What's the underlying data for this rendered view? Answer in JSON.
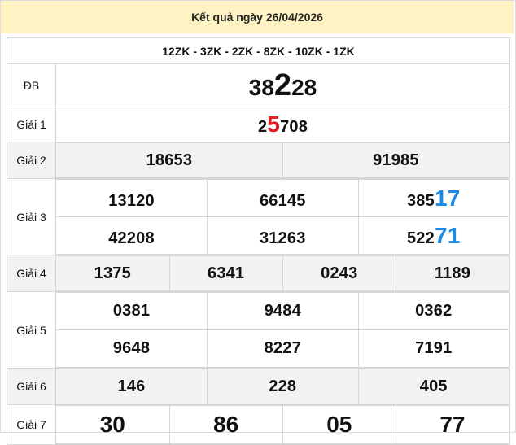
{
  "title": "Kết quả ngày 26/04/2026",
  "codes": "12ZK - 3ZK - 2ZK - 8ZK - 10ZK - 1ZK",
  "prizes": {
    "db": {
      "label": "ĐB",
      "a": "38",
      "b": "2",
      "c": "28"
    },
    "g1": {
      "label": "Giải 1",
      "a": "2",
      "b": "5",
      "c": "708"
    },
    "g2": {
      "label": "Giải 2",
      "values": [
        "18653",
        "91985"
      ]
    },
    "g3": {
      "label": "Giải 3",
      "values": [
        {
          "head": "13120",
          "tail": ""
        },
        {
          "head": "66145",
          "tail": ""
        },
        {
          "head": "385",
          "tail": "17"
        },
        {
          "head": "42208",
          "tail": ""
        },
        {
          "head": "31263",
          "tail": ""
        },
        {
          "head": "522",
          "tail": "71"
        }
      ]
    },
    "g4": {
      "label": "Giải 4",
      "values": [
        "1375",
        "6341",
        "0243",
        "1189"
      ]
    },
    "g5": {
      "label": "Giải 5",
      "values": [
        "0381",
        "9484",
        "0362",
        "9648",
        "8227",
        "7191"
      ]
    },
    "g6": {
      "label": "Giải 6",
      "values": [
        "146",
        "228",
        "405"
      ]
    },
    "g7": {
      "label": "Giải 7",
      "values": [
        "30",
        "86",
        "05",
        "77"
      ]
    }
  },
  "colors": {
    "header_bg": "#fff3c4",
    "red": "#e31b23",
    "blue": "#1a8be6",
    "code_blue": "#1f5fb8",
    "shade": "#f2f2f2"
  }
}
